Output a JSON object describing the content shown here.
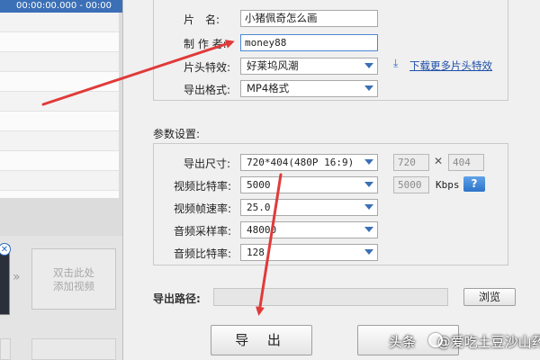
{
  "timeline": {
    "time_display": "00:00:00.000 - 00:00",
    "remove_glyph": "✕",
    "arrow_glyph": "»",
    "add_video_line1": "双击此处",
    "add_video_line2": "添加视频"
  },
  "form": {
    "title_label": "片　名:",
    "title_value": "小猪佩奇怎么画",
    "author_label": "制 作 者:",
    "author_value": "money88",
    "intro_label": "片头特效:",
    "intro_value": "好莱坞风潮",
    "download_link": "下载更多片头特效",
    "format_label": "导出格式:",
    "format_value": "MP4格式"
  },
  "params": {
    "heading": "参数设置:",
    "size_label": "导出尺寸:",
    "size_value": "720*404(480P 16:9)",
    "width_value": "720",
    "times_glyph": "✕",
    "height_value": "404",
    "vbitrate_label": "视频比特率:",
    "vbitrate_value": "5000",
    "vbitrate_readout": "5000",
    "kbps_label": "Kbps",
    "help_label": "?",
    "framerate_label": "视频帧速率:",
    "framerate_value": "25.0",
    "samplerate_label": "音频采样率:",
    "samplerate_value": "48000",
    "abitrate_label": "音频比特率:",
    "abitrate_value": "128"
  },
  "output": {
    "path_label": "导出路径:",
    "path_value": "",
    "browse_button": "浏览",
    "export_button": "导 出",
    "cancel_button": ""
  },
  "watermark": {
    "text1": "头条",
    "text2": "@爱吃土豆沙山药"
  },
  "colors": {
    "annotation_arrow": "#e03a3a",
    "accent": "#3b6fb6",
    "link": "#1f4fa8"
  },
  "icons": {
    "download": "download-icon",
    "help": "question-icon",
    "dropdown": "chevron-down-icon",
    "remove": "close-icon"
  }
}
